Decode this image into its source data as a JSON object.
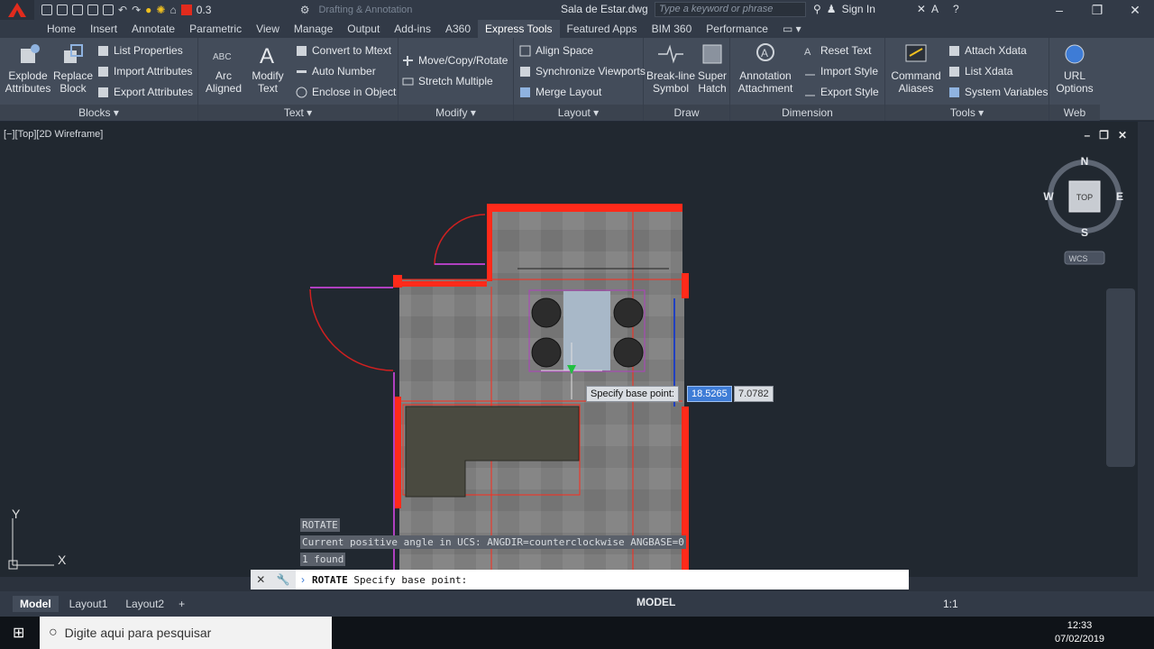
{
  "qat": {
    "workspace": "Drafting & Annotation",
    "layer_value": "0.3"
  },
  "title": {
    "document": "Sala de Estar.dwg",
    "search_placeholder": "Type a keyword or phrase",
    "sign_in": "Sign In"
  },
  "tabs": [
    "Home",
    "Insert",
    "Annotate",
    "Parametric",
    "View",
    "Manage",
    "Output",
    "Add-ins",
    "A360",
    "Express Tools",
    "Featured Apps",
    "BIM 360",
    "Performance"
  ],
  "active_tab": "Express Tools",
  "ribbon": {
    "blocks": {
      "title": "Blocks",
      "explode": "Explode Attributes",
      "replace": "Replace Block",
      "list_properties": "List Properties",
      "import_attributes": "Import Attributes",
      "export_attributes": "Export Attributes"
    },
    "text": {
      "title": "Text",
      "arc_aligned": "Arc Aligned",
      "modify_text": "Modify Text",
      "convert_mtext": "Convert to Mtext",
      "auto_number": "Auto Number",
      "enclose_object": "Enclose in Object"
    },
    "modify": {
      "title": "Modify",
      "move_copy_rotate": "Move/Copy/Rotate",
      "stretch_multiple": "Stretch Multiple"
    },
    "layout": {
      "title": "Layout",
      "align_space": "Align Space",
      "sync_viewports": "Synchronize Viewports",
      "merge_layout": "Merge Layout"
    },
    "draw": {
      "title": "Draw",
      "break_line": "Break-line Symbol",
      "super_hatch": "Super Hatch"
    },
    "dimension": {
      "title": "Dimension",
      "annotation_attachment": "Annotation Attachment",
      "reset_text": "Reset Text",
      "import_style": "Import Style",
      "export_style": "Export Style"
    },
    "tools": {
      "title": "Tools",
      "command_aliases": "Command Aliases",
      "attach_xdata": "Attach Xdata",
      "list_xdata": "List Xdata",
      "system_variables": "System Variables"
    },
    "web": {
      "title": "Web",
      "url_options": "URL Options"
    }
  },
  "viewport": {
    "label": "[−][Top][2D Wireframe]",
    "compass": {
      "n": "N",
      "s": "S",
      "e": "E",
      "w": "W",
      "top": "TOP",
      "wcs": "WCS"
    },
    "ucs_x": "X",
    "ucs_y": "Y"
  },
  "dynamic_input": {
    "prompt": "Specify base point:",
    "x": "18.5265",
    "y": "7.0782"
  },
  "command_history": [
    "ROTATE",
    "Current positive angle in UCS:  ANGDIR=counterclockwise  ANGBASE=0",
    "1 found"
  ],
  "command_line": {
    "cmd": "ROTATE",
    "prompt": "Specify base point:"
  },
  "layouts": [
    "Model",
    "Layout1",
    "Layout2"
  ],
  "status": {
    "model": "MODEL",
    "scale": "1:1"
  },
  "taskbar": {
    "search_placeholder": "Digite aqui para pesquisar",
    "time": "12:33",
    "date": "07/02/2019"
  },
  "colors": {
    "ribbon_bg": "#434c5a",
    "viewport_bg": "#212830",
    "wall": "#ff2a1a",
    "accent": "#3e7cd6"
  }
}
